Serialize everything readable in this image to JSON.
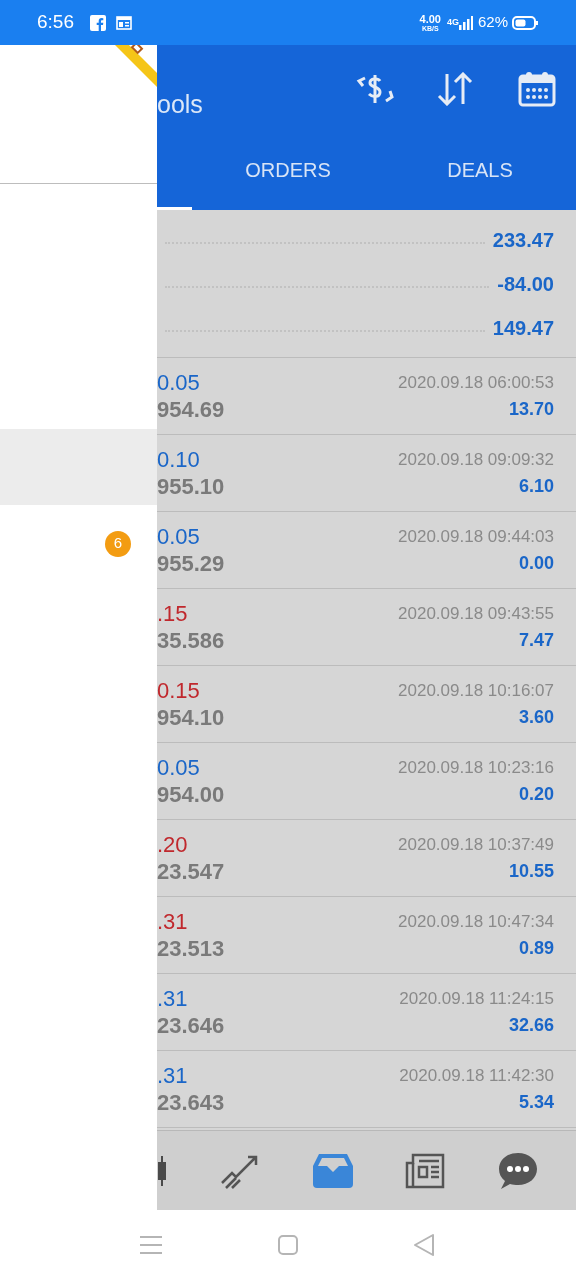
{
  "status_bar": {
    "time": "6:56",
    "speed": "4.00",
    "speed_unit": "KB/S",
    "network": "4G",
    "battery": "62%"
  },
  "drawer": {
    "badge": "6"
  },
  "app_bar": {
    "title": "ools"
  },
  "tabs": [
    {
      "label": "ORDERS",
      "selected": false
    },
    {
      "label": "DEALS",
      "selected": false
    }
  ],
  "summary": [
    "233.47",
    "-84.00",
    "149.47"
  ],
  "deals": [
    {
      "volume": "0.05",
      "kind": "buy",
      "price": "954.69",
      "time": "2020.09.18 06:00:53",
      "profit": "13.70"
    },
    {
      "volume": "0.10",
      "kind": "buy",
      "price": "955.10",
      "time": "2020.09.18 09:09:32",
      "profit": "6.10"
    },
    {
      "volume": "0.05",
      "kind": "buy",
      "price": "955.29",
      "time": "2020.09.18 09:44:03",
      "profit": "0.00"
    },
    {
      "volume": ".15",
      "kind": "sell",
      "price": "35.586",
      "time": "2020.09.18 09:43:55",
      "profit": "7.47"
    },
    {
      "volume": "0.15",
      "kind": "sell",
      "price": "954.10",
      "time": "2020.09.18 10:16:07",
      "profit": "3.60"
    },
    {
      "volume": "0.05",
      "kind": "buy",
      "price": "954.00",
      "time": "2020.09.18 10:23:16",
      "profit": "0.20"
    },
    {
      "volume": ".20",
      "kind": "sell",
      "price": "23.547",
      "time": "2020.09.18 10:37:49",
      "profit": "10.55"
    },
    {
      "volume": ".31",
      "kind": "sell",
      "price": "23.513",
      "time": "2020.09.18 10:47:34",
      "profit": "0.89"
    },
    {
      "volume": ".31",
      "kind": "buy",
      "price": "23.646",
      "time": "2020.09.18 11:24:15",
      "profit": "32.66"
    },
    {
      "volume": ".31",
      "kind": "buy",
      "price": "23.643",
      "time": "2020.09.18 11:42:30",
      "profit": "5.34"
    }
  ]
}
